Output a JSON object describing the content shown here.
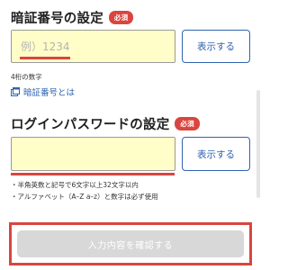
{
  "pin": {
    "title": "暗証番号の設定",
    "badge": "必須",
    "placeholder": "例）1234",
    "value": "",
    "show_button": "表示する",
    "hint": "4桁の数字",
    "help_link": "暗証番号とは"
  },
  "login_password": {
    "title": "ログインパスワードの設定",
    "badge": "必須",
    "value": "",
    "show_button": "表示する",
    "notes": [
      "・半角英数と記号で6文字以上32文字以内",
      "・アルファベット（A–Z a–z）と数字は必ず使用"
    ]
  },
  "confirm_button": "入力内容を確認する",
  "colors": {
    "accent_red": "#d9453f",
    "link_blue": "#2f63b0",
    "field_bg": "#fffec8",
    "disabled_button": "#d8d8d8"
  }
}
